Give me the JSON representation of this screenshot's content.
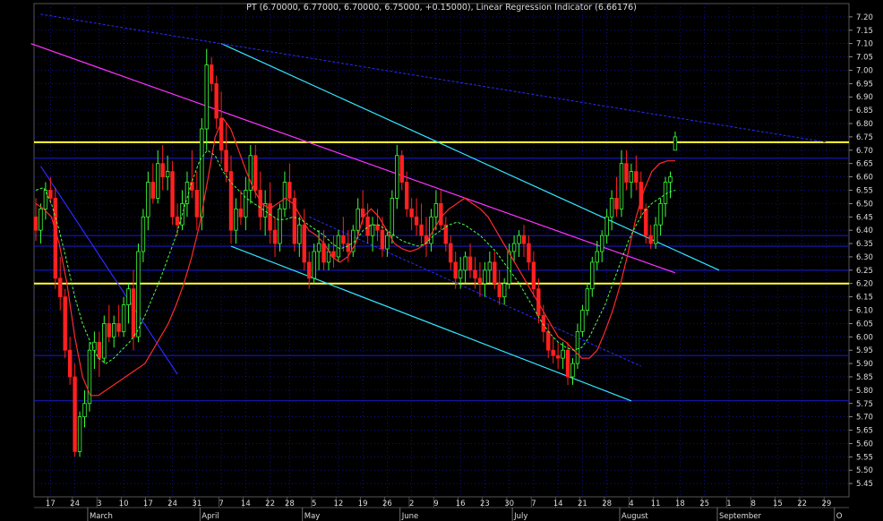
{
  "title": "PT (6.70000, 6.77000, 6.70000, 6.75000, +0.15000), Linear Regression Indicator (6.66176)",
  "colors": {
    "background": "#000000",
    "grid": "#1a1ad6",
    "up": "#3cff3c",
    "down": "#ff2020",
    "lri": "#ff2a2a",
    "ma": "#49ff49",
    "support": "#ffff33",
    "channel": "#33e6ff",
    "trend": "#ff33ff",
    "blueTrend": "#2a2aff",
    "axisText": "#dddddd"
  },
  "chart_data": {
    "type": "candlestick",
    "ylim": [
      5.4,
      7.25
    ],
    "y_ticks": [
      "5.45",
      "5.50",
      "5.55",
      "5.60",
      "5.65",
      "5.70",
      "5.75",
      "5.80",
      "5.85",
      "5.90",
      "5.95",
      "6.00",
      "6.05",
      "6.10",
      "6.15",
      "6.20",
      "6.25",
      "6.30",
      "6.35",
      "6.40",
      "6.45",
      "6.50",
      "6.55",
      "6.60",
      "6.65",
      "6.70",
      "6.75",
      "6.80",
      "6.85",
      "6.90",
      "6.95",
      "7.00",
      "7.05",
      "7.10",
      "7.15",
      "7.20"
    ],
    "x_day_ticks": [
      {
        "i": 3,
        "label": "17"
      },
      {
        "i": 8,
        "label": "24"
      },
      {
        "i": 13,
        "label": "3"
      },
      {
        "i": 18,
        "label": "10"
      },
      {
        "i": 23,
        "label": "17"
      },
      {
        "i": 28,
        "label": "24"
      },
      {
        "i": 33,
        "label": "31"
      },
      {
        "i": 38,
        "label": "7"
      },
      {
        "i": 43,
        "label": "14"
      },
      {
        "i": 48,
        "label": "22"
      },
      {
        "i": 52,
        "label": "28"
      },
      {
        "i": 57,
        "label": "5"
      },
      {
        "i": 62,
        "label": "12"
      },
      {
        "i": 67,
        "label": "19"
      },
      {
        "i": 72,
        "label": "26"
      },
      {
        "i": 77,
        "label": "2"
      },
      {
        "i": 82,
        "label": "9"
      },
      {
        "i": 87,
        "label": "16"
      },
      {
        "i": 92,
        "label": "23"
      },
      {
        "i": 97,
        "label": "30"
      },
      {
        "i": 102,
        "label": "7"
      },
      {
        "i": 107,
        "label": "14"
      },
      {
        "i": 112,
        "label": "21"
      },
      {
        "i": 117,
        "label": "28"
      },
      {
        "i": 122,
        "label": "4"
      },
      {
        "i": 127,
        "label": "11"
      },
      {
        "i": 132,
        "label": "18"
      },
      {
        "i": 137,
        "label": "25"
      },
      {
        "i": 142,
        "label": "1"
      },
      {
        "i": 147,
        "label": "8"
      },
      {
        "i": 152,
        "label": "15"
      },
      {
        "i": 157,
        "label": "22"
      },
      {
        "i": 162,
        "label": "29"
      }
    ],
    "x_month_ticks": [
      {
        "i": 11,
        "label": "March"
      },
      {
        "i": 34,
        "label": "April"
      },
      {
        "i": 55,
        "label": "May"
      },
      {
        "i": 75,
        "label": "June"
      },
      {
        "i": 98,
        "label": "July"
      },
      {
        "i": 120,
        "label": "August"
      },
      {
        "i": 140,
        "label": "September"
      },
      {
        "i": 164,
        "label": "O"
      }
    ],
    "horizontal_lines": [
      {
        "y": 6.73,
        "kind": "support"
      },
      {
        "y": 6.2,
        "kind": "support"
      },
      {
        "y": 6.67,
        "kind": "grid"
      },
      {
        "y": 6.38,
        "kind": "grid"
      },
      {
        "y": 6.34,
        "kind": "grid"
      },
      {
        "y": 6.25,
        "kind": "grid"
      },
      {
        "y": 5.93,
        "kind": "grid"
      },
      {
        "y": 5.76,
        "kind": "grid"
      }
    ],
    "trend_lines": [
      {
        "kind": "trend",
        "x1": -1,
        "y1": 7.1,
        "x2": 131,
        "y2": 6.24
      },
      {
        "kind": "channel",
        "x1": 38,
        "y1": 7.1,
        "x2": 140,
        "y2": 6.25
      },
      {
        "kind": "channel",
        "x1": 40,
        "y1": 6.34,
        "x2": 122,
        "y2": 5.76
      },
      {
        "kind": "blueTrend",
        "x1": 1,
        "y1": 6.64,
        "x2": 29,
        "y2": 5.86
      },
      {
        "kind": "blueTrendDash",
        "x1": 1,
        "y1": 7.21,
        "x2": 162,
        "y2": 6.73
      },
      {
        "kind": "blueTrendDash",
        "x1": 56,
        "y1": 6.45,
        "x2": 124,
        "y2": 5.89
      }
    ],
    "ohlc": [
      [
        6.45,
        6.52,
        6.36,
        6.4
      ],
      [
        6.4,
        6.5,
        6.35,
        6.48
      ],
      [
        6.48,
        6.58,
        6.44,
        6.55
      ],
      [
        6.55,
        6.6,
        6.5,
        6.52
      ],
      [
        6.52,
        6.56,
        6.18,
        6.22
      ],
      [
        6.22,
        6.3,
        6.1,
        6.15
      ],
      [
        6.15,
        6.18,
        5.92,
        5.95
      ],
      [
        5.95,
        6.0,
        5.82,
        5.85
      ],
      [
        5.85,
        5.9,
        5.55,
        5.57
      ],
      [
        5.57,
        5.72,
        5.55,
        5.7
      ],
      [
        5.7,
        5.8,
        5.66,
        5.75
      ],
      [
        5.75,
        5.98,
        5.72,
        5.95
      ],
      [
        5.95,
        6.02,
        5.88,
        5.98
      ],
      [
        5.98,
        6.02,
        5.85,
        5.92
      ],
      [
        5.92,
        6.08,
        5.9,
        6.05
      ],
      [
        6.05,
        6.12,
        5.98,
        6.0
      ],
      [
        6.0,
        6.08,
        5.96,
        6.05
      ],
      [
        6.05,
        6.12,
        6.0,
        6.02
      ],
      [
        6.02,
        6.15,
        6.0,
        6.12
      ],
      [
        6.12,
        6.2,
        6.05,
        6.18
      ],
      [
        6.18,
        6.25,
        5.95,
        6.0
      ],
      [
        6.0,
        6.35,
        5.98,
        6.32
      ],
      [
        6.32,
        6.48,
        6.28,
        6.45
      ],
      [
        6.45,
        6.62,
        6.4,
        6.58
      ],
      [
        6.58,
        6.65,
        6.5,
        6.52
      ],
      [
        6.52,
        6.7,
        6.5,
        6.65
      ],
      [
        6.65,
        6.72,
        6.55,
        6.6
      ],
      [
        6.6,
        6.68,
        6.55,
        6.62
      ],
      [
        6.62,
        6.66,
        6.42,
        6.45
      ],
      [
        6.45,
        6.5,
        6.38,
        6.42
      ],
      [
        6.42,
        6.55,
        6.4,
        6.5
      ],
      [
        6.5,
        6.62,
        6.45,
        6.58
      ],
      [
        6.58,
        6.7,
        6.52,
        6.55
      ],
      [
        6.55,
        6.62,
        6.4,
        6.45
      ],
      [
        6.45,
        6.82,
        6.4,
        6.78
      ],
      [
        6.78,
        7.08,
        6.7,
        7.02
      ],
      [
        7.02,
        7.05,
        6.92,
        6.95
      ],
      [
        6.95,
        6.98,
        6.78,
        6.82
      ],
      [
        6.82,
        6.92,
        6.65,
        6.7
      ],
      [
        6.7,
        6.8,
        6.58,
        6.62
      ],
      [
        6.62,
        6.68,
        6.35,
        6.4
      ],
      [
        6.4,
        6.52,
        6.35,
        6.48
      ],
      [
        6.48,
        6.55,
        6.42,
        6.45
      ],
      [
        6.45,
        6.6,
        6.4,
        6.55
      ],
      [
        6.55,
        6.72,
        6.5,
        6.68
      ],
      [
        6.68,
        6.72,
        6.52,
        6.55
      ],
      [
        6.55,
        6.62,
        6.4,
        6.45
      ],
      [
        6.45,
        6.55,
        6.38,
        6.5
      ],
      [
        6.5,
        6.58,
        6.35,
        6.4
      ],
      [
        6.4,
        6.45,
        6.3,
        6.35
      ],
      [
        6.35,
        6.5,
        6.32,
        6.48
      ],
      [
        6.48,
        6.62,
        6.45,
        6.58
      ],
      [
        6.58,
        6.65,
        6.48,
        6.52
      ],
      [
        6.52,
        6.55,
        6.32,
        6.35
      ],
      [
        6.35,
        6.45,
        6.3,
        6.42
      ],
      [
        6.42,
        6.48,
        6.25,
        6.28
      ],
      [
        6.28,
        6.32,
        6.18,
        6.22
      ],
      [
        6.22,
        6.35,
        6.2,
        6.32
      ],
      [
        6.32,
        6.4,
        6.25,
        6.35
      ],
      [
        6.35,
        6.4,
        6.25,
        6.28
      ],
      [
        6.28,
        6.35,
        6.25,
        6.32
      ],
      [
        6.32,
        6.38,
        6.26,
        6.3
      ],
      [
        6.3,
        6.4,
        6.28,
        6.38
      ],
      [
        6.38,
        6.45,
        6.32,
        6.35
      ],
      [
        6.35,
        6.4,
        6.28,
        6.32
      ],
      [
        6.32,
        6.42,
        6.3,
        6.4
      ],
      [
        6.4,
        6.52,
        6.38,
        6.48
      ],
      [
        6.48,
        6.55,
        6.42,
        6.45
      ],
      [
        6.45,
        6.5,
        6.35,
        6.38
      ],
      [
        6.38,
        6.45,
        6.32,
        6.42
      ],
      [
        6.42,
        6.48,
        6.36,
        6.4
      ],
      [
        6.4,
        6.45,
        6.3,
        6.33
      ],
      [
        6.33,
        6.4,
        6.3,
        6.38
      ],
      [
        6.38,
        6.55,
        6.35,
        6.52
      ],
      [
        6.52,
        6.72,
        6.48,
        6.68
      ],
      [
        6.68,
        6.7,
        6.55,
        6.58
      ],
      [
        6.58,
        6.62,
        6.45,
        6.48
      ],
      [
        6.48,
        6.52,
        6.4,
        6.45
      ],
      [
        6.45,
        6.52,
        6.38,
        6.42
      ],
      [
        6.42,
        6.5,
        6.35,
        6.38
      ],
      [
        6.38,
        6.45,
        6.3,
        6.35
      ],
      [
        6.35,
        6.48,
        6.32,
        6.45
      ],
      [
        6.45,
        6.55,
        6.4,
        6.5
      ],
      [
        6.5,
        6.55,
        6.4,
        6.42
      ],
      [
        6.42,
        6.45,
        6.32,
        6.35
      ],
      [
        6.35,
        6.38,
        6.25,
        6.28
      ],
      [
        6.28,
        6.32,
        6.18,
        6.22
      ],
      [
        6.22,
        6.3,
        6.18,
        6.25
      ],
      [
        6.25,
        6.32,
        6.2,
        6.3
      ],
      [
        6.3,
        6.35,
        6.22,
        6.25
      ],
      [
        6.25,
        6.3,
        6.18,
        6.22
      ],
      [
        6.22,
        6.28,
        6.15,
        6.2
      ],
      [
        6.2,
        6.28,
        6.15,
        6.25
      ],
      [
        6.25,
        6.32,
        6.2,
        6.28
      ],
      [
        6.28,
        6.32,
        6.18,
        6.2
      ],
      [
        6.2,
        6.25,
        6.12,
        6.15
      ],
      [
        6.15,
        6.22,
        6.12,
        6.2
      ],
      [
        6.2,
        6.35,
        6.18,
        6.32
      ],
      [
        6.32,
        6.38,
        6.28,
        6.35
      ],
      [
        6.35,
        6.4,
        6.3,
        6.38
      ],
      [
        6.38,
        6.42,
        6.3,
        6.35
      ],
      [
        6.35,
        6.38,
        6.25,
        6.28
      ],
      [
        6.28,
        6.32,
        6.15,
        6.18
      ],
      [
        6.18,
        6.22,
        6.05,
        6.08
      ],
      [
        6.08,
        6.12,
        5.98,
        6.02
      ],
      [
        6.02,
        6.05,
        5.92,
        5.95
      ],
      [
        5.95,
        6.0,
        5.9,
        5.93
      ],
      [
        5.93,
        5.98,
        5.88,
        5.92
      ],
      [
        5.92,
        5.98,
        5.88,
        5.95
      ],
      [
        5.95,
        5.98,
        5.82,
        5.85
      ],
      [
        5.85,
        5.92,
        5.82,
        5.9
      ],
      [
        5.9,
        6.05,
        5.88,
        6.02
      ],
      [
        6.02,
        6.12,
        6.0,
        6.1
      ],
      [
        6.1,
        6.2,
        6.08,
        6.18
      ],
      [
        6.18,
        6.3,
        6.15,
        6.28
      ],
      [
        6.28,
        6.36,
        6.25,
        6.32
      ],
      [
        6.32,
        6.4,
        6.28,
        6.38
      ],
      [
        6.38,
        6.48,
        6.35,
        6.45
      ],
      [
        6.45,
        6.55,
        6.4,
        6.52
      ],
      [
        6.52,
        6.6,
        6.45,
        6.48
      ],
      [
        6.48,
        6.7,
        6.45,
        6.65
      ],
      [
        6.65,
        6.7,
        6.55,
        6.58
      ],
      [
        6.58,
        6.65,
        6.52,
        6.62
      ],
      [
        6.62,
        6.68,
        6.55,
        6.58
      ],
      [
        6.58,
        6.62,
        6.45,
        6.48
      ],
      [
        6.48,
        6.5,
        6.35,
        6.38
      ],
      [
        6.38,
        6.42,
        6.33,
        6.35
      ],
      [
        6.35,
        6.45,
        6.33,
        6.42
      ],
      [
        6.42,
        6.52,
        6.38,
        6.5
      ],
      [
        6.5,
        6.6,
        6.45,
        6.58
      ],
      [
        6.58,
        6.62,
        6.52,
        6.6
      ],
      [
        6.7,
        6.77,
        6.7,
        6.75
      ]
    ],
    "series": [
      {
        "kind": "lri",
        "values": [
          6.5,
          6.48,
          6.45,
          6.35,
          6.2,
          6.0,
          5.85,
          5.78,
          5.78,
          5.8,
          5.82,
          5.84,
          5.86,
          5.88,
          5.9,
          5.95,
          6.0,
          6.05,
          6.12,
          6.2,
          6.3,
          6.42,
          6.58,
          6.75,
          6.82,
          6.78,
          6.7,
          6.62,
          6.55,
          6.5,
          6.48,
          6.5,
          6.52,
          6.5,
          6.45,
          6.4,
          6.38,
          6.35,
          6.3,
          6.28,
          6.3,
          6.35,
          6.45,
          6.48,
          6.45,
          6.4,
          6.35,
          6.33,
          6.32,
          6.33,
          6.35,
          6.4,
          6.45,
          6.48,
          6.5,
          6.52,
          6.5,
          6.48,
          6.45,
          6.4,
          6.35,
          6.3,
          6.25,
          6.2,
          6.15,
          6.1,
          6.05,
          6.0,
          5.98,
          5.95,
          5.92,
          5.92,
          5.95,
          6.02,
          6.1,
          6.2,
          6.32,
          6.45,
          6.55,
          6.62,
          6.65,
          6.66,
          6.66
        ]
      },
      {
        "kind": "ma",
        "values": [
          6.55,
          6.56,
          6.5,
          6.4,
          6.28,
          6.15,
          6.05,
          5.98,
          5.92,
          5.9,
          5.92,
          5.95,
          5.98,
          6.02,
          6.08,
          6.15,
          6.22,
          6.3,
          6.38,
          6.48,
          6.58,
          6.66,
          6.7,
          6.68,
          6.62,
          6.58,
          6.55,
          6.52,
          6.5,
          6.48,
          6.46,
          6.44,
          6.44,
          6.45,
          6.44,
          6.42,
          6.4,
          6.38,
          6.35,
          6.33,
          6.34,
          6.36,
          6.4,
          6.42,
          6.42,
          6.4,
          6.38,
          6.36,
          6.35,
          6.34,
          6.35,
          6.38,
          6.4,
          6.42,
          6.43,
          6.42,
          6.4,
          6.38,
          6.35,
          6.32,
          6.28,
          6.24,
          6.2,
          6.15,
          6.1,
          6.05,
          6.01,
          5.98,
          5.96,
          5.95,
          5.96,
          6.0,
          6.06,
          6.12,
          6.2,
          6.28,
          6.36,
          6.42,
          6.47,
          6.5,
          6.52,
          6.54,
          6.55
        ]
      }
    ]
  }
}
